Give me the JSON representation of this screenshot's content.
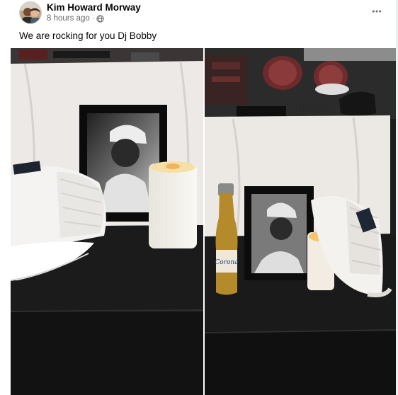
{
  "post": {
    "author": "Kim Howard Morway",
    "timestamp": "8 hours ago",
    "separator": "·",
    "privacy_icon": "globe-icon",
    "more_icon": "more-options-icon",
    "caption": "We are rocking for you Dj Bobby"
  },
  "photos": {
    "beer_label": "Corona"
  },
  "colors": {
    "name": "#050505",
    "meta": "#65676b",
    "background": "#ffffff"
  }
}
